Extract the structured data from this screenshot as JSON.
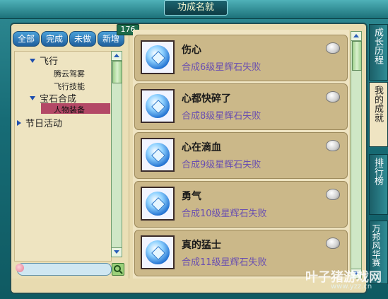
{
  "window": {
    "title": "功成名就"
  },
  "filters": {
    "tabs": [
      "全部",
      "完成",
      "未做",
      "新增"
    ],
    "new_count": "176"
  },
  "tree": {
    "items": [
      {
        "label": "飞行",
        "level": 1
      },
      {
        "label": "腾云驾雾",
        "level": 2
      },
      {
        "label": "飞行技能",
        "level": 2
      },
      {
        "label": "宝石合成",
        "level": 1
      },
      {
        "label": "人物装备",
        "level": 2,
        "selected": true
      },
      {
        "label": "节日活动",
        "level": 0
      }
    ]
  },
  "search": {
    "placeholder": ""
  },
  "achievements": [
    {
      "title": "伤心",
      "desc": "合成6级星辉石失败",
      "icon": "blue-gem-icon"
    },
    {
      "title": "心都快碎了",
      "desc": "合成8级星辉石失败",
      "icon": "blue-gem-icon"
    },
    {
      "title": "心在滴血",
      "desc": "合成9级星辉石失败",
      "icon": "blue-gem-icon"
    },
    {
      "title": "勇气",
      "desc": "合成10级星辉石失败",
      "icon": "blue-gem-icon"
    },
    {
      "title": "真的猛士",
      "desc": "合成11级星辉石失败",
      "icon": "blue-gem-icon"
    }
  ],
  "side_tabs": [
    {
      "label": "成长历程",
      "active": false
    },
    {
      "label": "我的成就",
      "active": true
    },
    {
      "label": "排行榜",
      "active": false
    },
    {
      "label": "万邦风华赛",
      "active": false
    }
  ],
  "watermark": {
    "brand": "叶子猪游戏网",
    "url": "www.yzz.cn"
  },
  "colors": {
    "frame": "#176c76",
    "panel": "#e8dbb0",
    "selected": "#b34866",
    "desc_text": "#6a4fb0"
  }
}
